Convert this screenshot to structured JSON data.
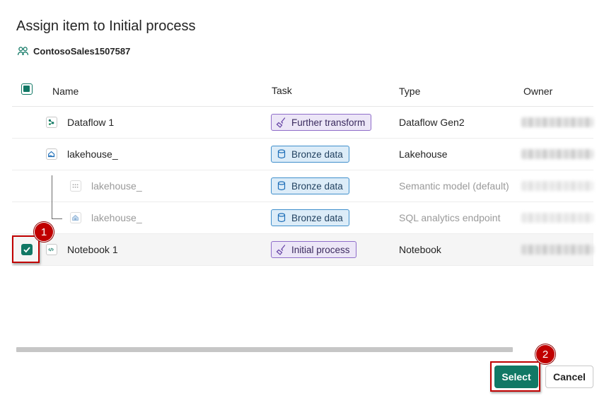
{
  "dialog": {
    "title": "Assign item to Initial process",
    "workspace": "ContosoSales1507587"
  },
  "table": {
    "headers": {
      "name": "Name",
      "task": "Task",
      "type": "Type",
      "owner": "Owner"
    },
    "rows": [
      {
        "name": "Dataflow 1",
        "task": "Further transform",
        "task_color": "purple",
        "type": "Dataflow Gen2",
        "icon": "dataflow-icon"
      },
      {
        "name": "lakehouse_",
        "task": "Bronze data",
        "task_color": "blue",
        "type": "Lakehouse",
        "icon": "lakehouse-icon"
      },
      {
        "name": "lakehouse_",
        "task": "Bronze data",
        "task_color": "blue",
        "type": "Semantic model (default)",
        "icon": "semantic-model-icon"
      },
      {
        "name": "lakehouse_",
        "task": "Bronze data",
        "task_color": "blue",
        "type": "SQL analytics endpoint",
        "icon": "sql-endpoint-icon"
      },
      {
        "name": "Notebook 1",
        "task": "Initial process",
        "task_color": "purple",
        "type": "Notebook",
        "icon": "notebook-icon",
        "selected": true
      }
    ]
  },
  "buttons": {
    "select": "Select",
    "cancel": "Cancel"
  },
  "callouts": {
    "one": "1",
    "two": "2"
  },
  "colors": {
    "accent": "#117865",
    "callout": "#c00000",
    "task_purple": "#8f6dc9",
    "task_blue": "#3f8fcc"
  }
}
